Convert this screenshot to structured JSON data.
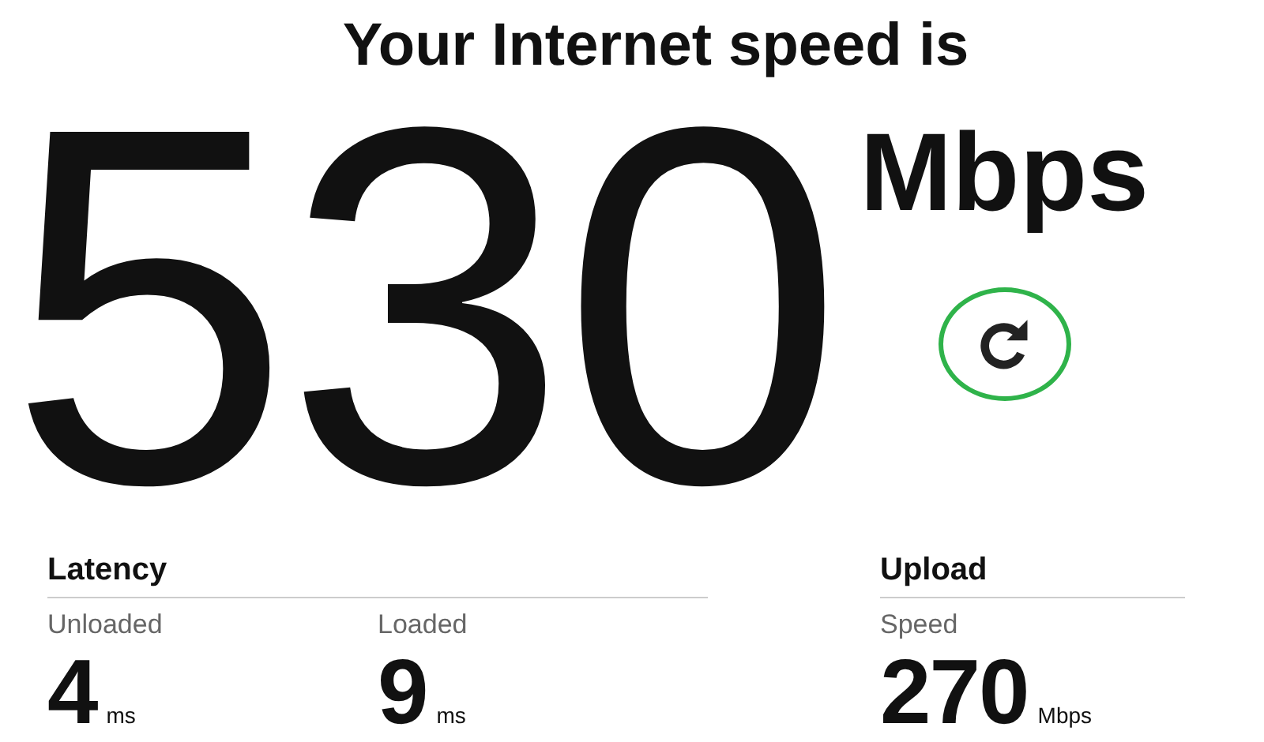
{
  "title": "Your Internet speed is",
  "speed": {
    "value": "530",
    "unit": "Mbps"
  },
  "refresh_button": {
    "kind": "refresh"
  },
  "sections": [
    {
      "heading": "Latency",
      "metrics": [
        {
          "label": "Unloaded",
          "value": "4",
          "unit": "ms"
        },
        {
          "label": "Loaded",
          "value": "9",
          "unit": "ms"
        }
      ]
    },
    {
      "heading": "Upload",
      "metrics": [
        {
          "label": "Speed",
          "value": "270",
          "unit": "Mbps"
        }
      ]
    }
  ]
}
